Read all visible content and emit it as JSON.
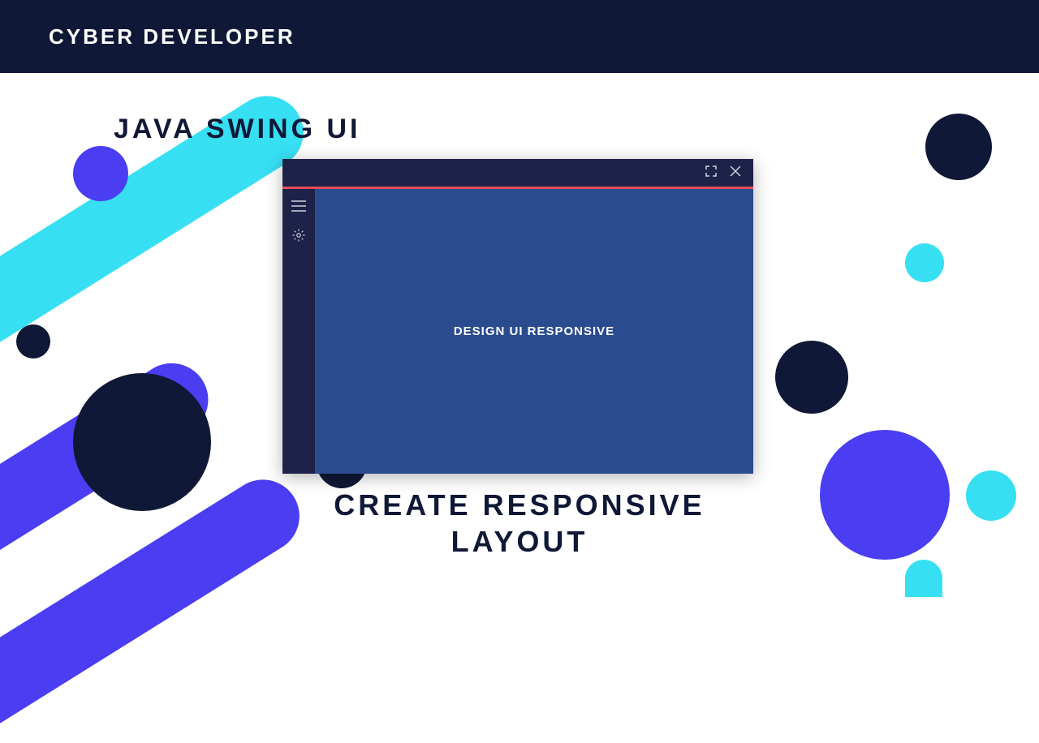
{
  "header": {
    "title": "CYBER DEVELOPER"
  },
  "subtitle": "JAVA SWING UI",
  "bottom_line1": "CREATE RESPONSIVE",
  "bottom_line2": "LAYOUT",
  "window": {
    "content_text": "DESIGN UI RESPONSIVE"
  }
}
